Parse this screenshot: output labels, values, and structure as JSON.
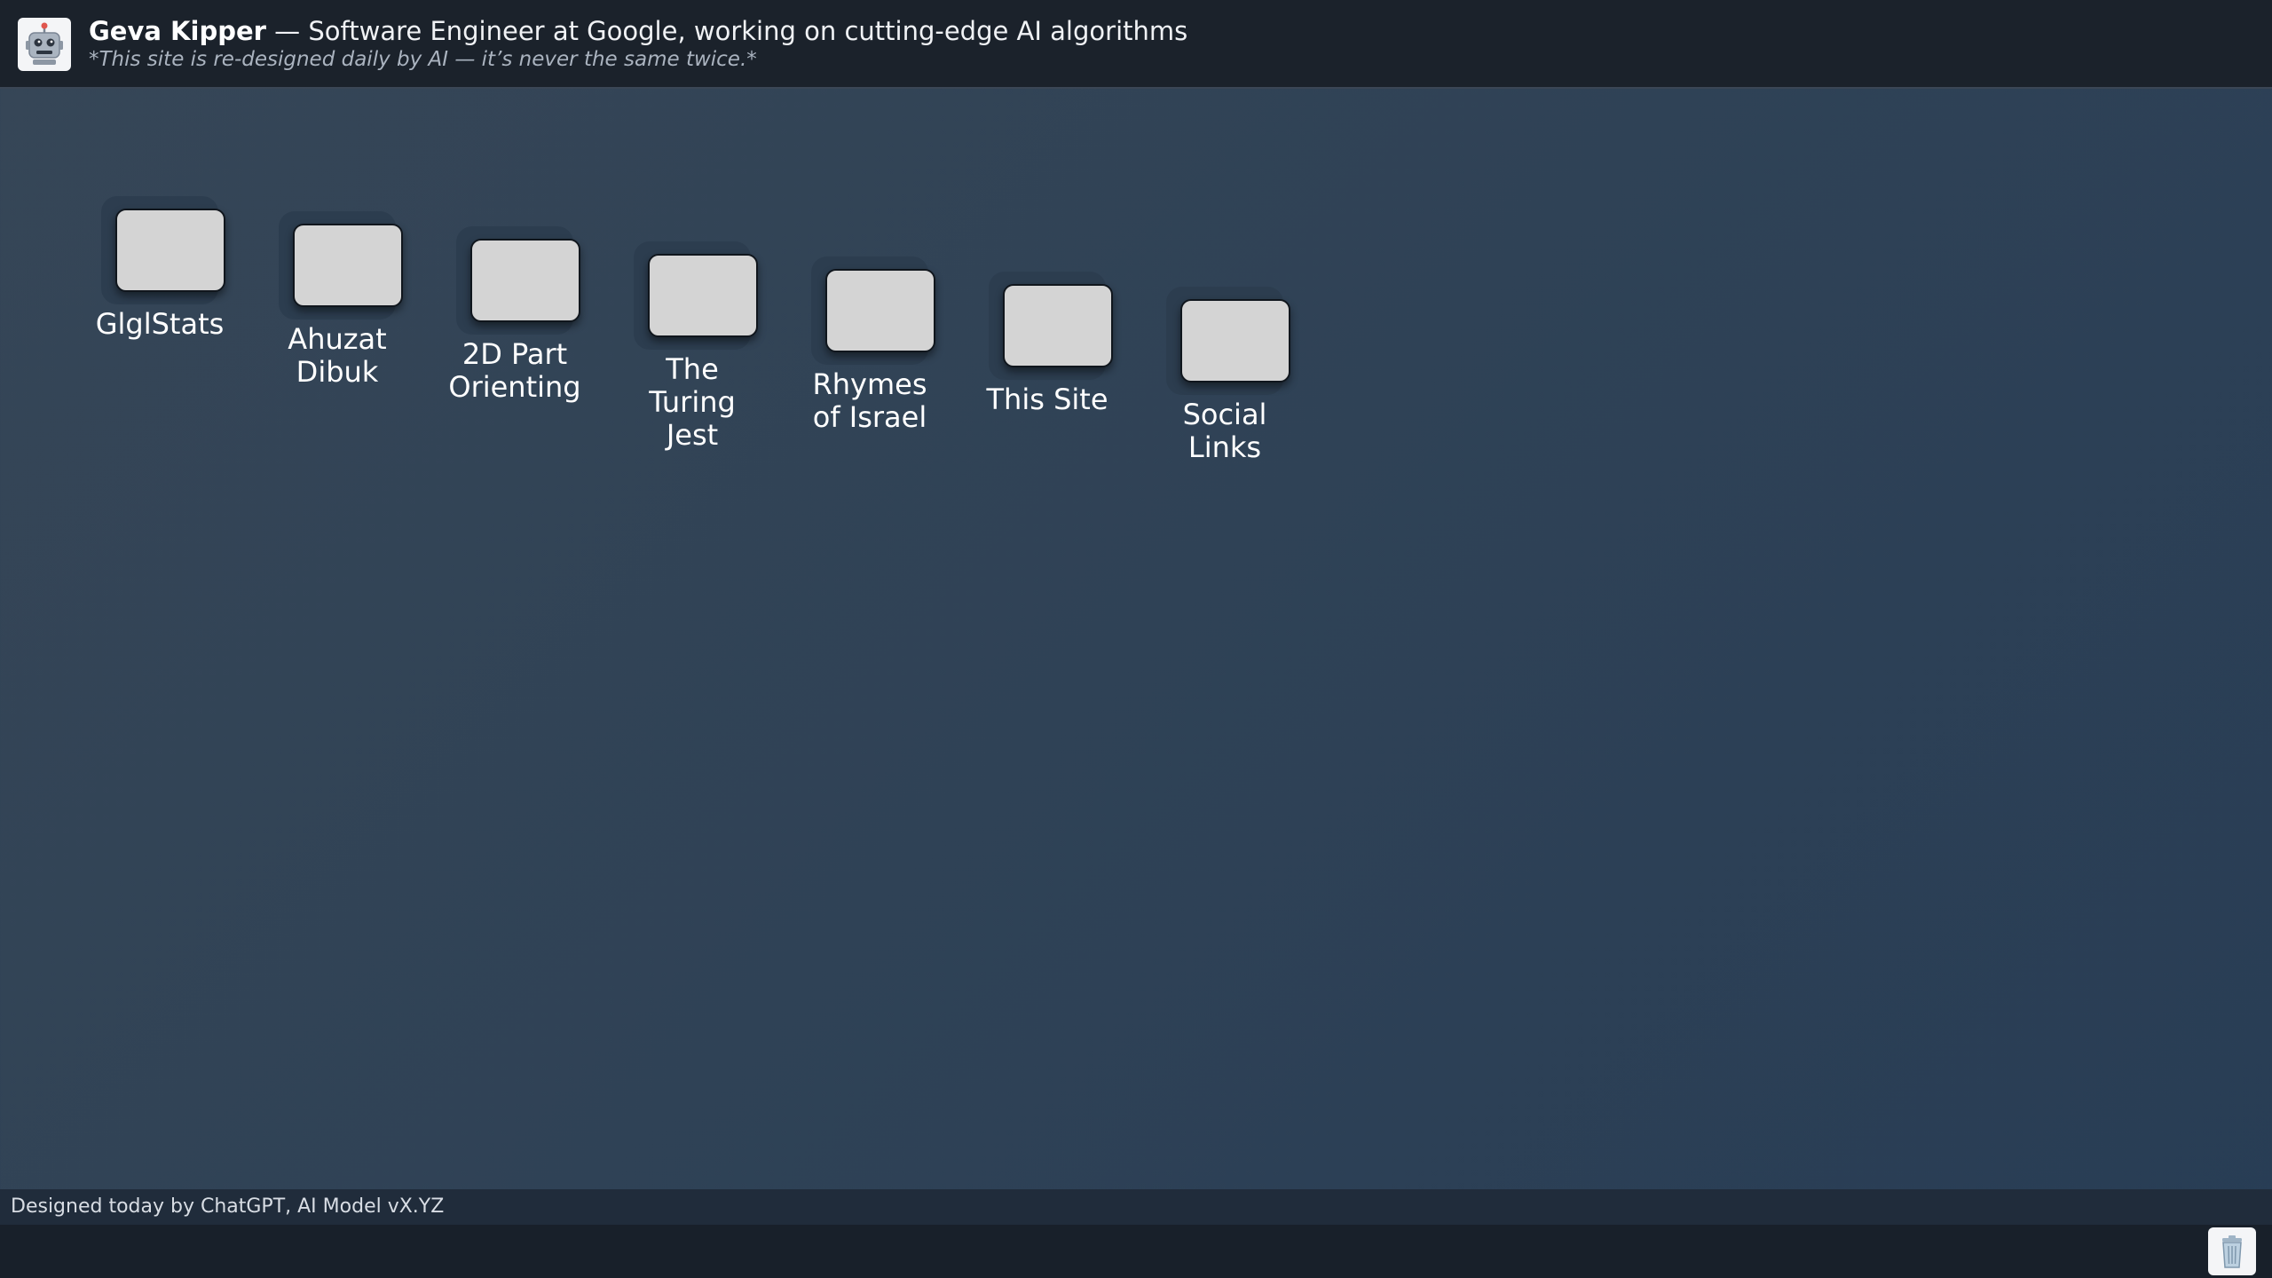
{
  "header": {
    "name": "Geva Kipper",
    "tagline": " — Software Engineer at Google, working on cutting-edge AI algorithms",
    "subtitle": "*This site is re-designed daily by AI — it’s never the same twice.*",
    "avatar_icon": "robot-icon"
  },
  "desktop": {
    "icons": [
      {
        "label": "GlglStats"
      },
      {
        "label": "Ahuzat Dibuk"
      },
      {
        "label": "2D Part Orienting"
      },
      {
        "label": "The Turing Jest"
      },
      {
        "label": "Rhymes of Israel"
      },
      {
        "label": "This Site"
      },
      {
        "label": "Social Links"
      }
    ]
  },
  "footer": {
    "text": "Designed today by ChatGPT, AI Model vX.YZ"
  },
  "taskbar": {
    "trash_icon": "trash-icon"
  }
}
